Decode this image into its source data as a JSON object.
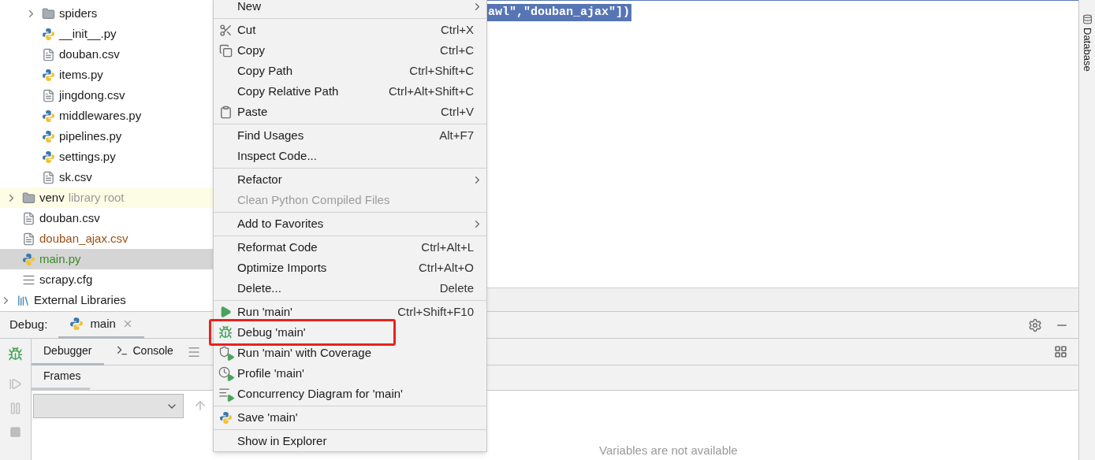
{
  "project_tree": [
    {
      "children": [
        {
          "children": [
            {
              "label": "spiders",
              "kind": "folder",
              "expanded": false,
              "selected": false
            },
            {
              "label": "__init__.py",
              "kind": "python",
              "selected": false
            },
            {
              "label": "douban.csv",
              "kind": "text",
              "selected": false
            },
            {
              "label": "items.py",
              "kind": "python",
              "selected": false
            },
            {
              "label": "jingdong.csv",
              "kind": "text",
              "selected": false
            },
            {
              "label": "middlewares.py",
              "kind": "python",
              "selected": false
            },
            {
              "label": "pipelines.py",
              "kind": "python",
              "selected": false
            },
            {
              "label": "settings.py",
              "kind": "python",
              "selected": false
            },
            {
              "label": "sk.csv",
              "kind": "text",
              "selected": false
            }
          ]
        },
        {
          "label": "venv",
          "suffix": "library root",
          "kind": "folder",
          "expanded": false,
          "selected": false
        },
        {
          "label": "douban.csv",
          "kind": "text",
          "selected": false
        },
        {
          "label": "douban_ajax.csv",
          "kind": "text",
          "selected": false,
          "color": "#9b4f16"
        },
        {
          "label": "main.py",
          "kind": "python",
          "selected": true,
          "color": "#3a8a28"
        },
        {
          "label": "scrapy.cfg",
          "kind": "config",
          "selected": false
        }
      ]
    },
    {
      "label": "External Libraries",
      "kind": "libraries",
      "expanded": false,
      "selected": false
    }
  ],
  "editor": {
    "lines": [
      {
        "text": "awl\",\"douban_ajax\"])",
        "selected": true
      }
    ]
  },
  "right_strip": {
    "label": "Database"
  },
  "debug_panel": {
    "label": "Debug:",
    "tabs": [
      {
        "label": "main",
        "selected": true
      }
    ],
    "views": [
      {
        "label": "Debugger",
        "selected": true
      },
      {
        "label": "Console",
        "selected": false
      }
    ],
    "frames": {
      "tabs": [
        {
          "label": "Frames",
          "selected": true
        }
      ]
    },
    "variables": {
      "message": "Variables are not available"
    }
  },
  "context_menu": {
    "groups": [
      [
        {
          "label": "New",
          "kind": "plain",
          "submenu": true
        }
      ],
      [
        {
          "label": "Cut",
          "shortcut": "Ctrl+X",
          "kind": "cut"
        },
        {
          "label": "Copy",
          "shortcut": "Ctrl+C",
          "kind": "copy"
        },
        {
          "label": "Copy Path",
          "shortcut": "Ctrl+Shift+C",
          "kind": "plain"
        },
        {
          "label": "Copy Relative Path",
          "shortcut": "Ctrl+Alt+Shift+C",
          "kind": "plain"
        },
        {
          "label": "Paste",
          "shortcut": "Ctrl+V",
          "kind": "paste"
        }
      ],
      [
        {
          "label": "Find Usages",
          "shortcut": "Alt+F7",
          "kind": "plain"
        },
        {
          "label": "Inspect Code...",
          "kind": "plain"
        }
      ],
      [
        {
          "label": "Refactor",
          "kind": "plain",
          "submenu": true
        },
        {
          "label": "Clean Python Compiled Files",
          "kind": "plain",
          "disabled": true
        }
      ],
      [
        {
          "label": "Add to Favorites",
          "kind": "plain",
          "submenu": true
        }
      ],
      [
        {
          "label": "Reformat Code",
          "shortcut": "Ctrl+Alt+L",
          "kind": "plain"
        },
        {
          "label": "Optimize Imports",
          "shortcut": "Ctrl+Alt+O",
          "kind": "plain"
        },
        {
          "label": "Delete...",
          "shortcut": "Delete",
          "kind": "plain"
        }
      ],
      [
        {
          "label": "Run 'main'",
          "shortcut": "Ctrl+Shift+F10",
          "kind": "run"
        },
        {
          "label": "Debug 'main'",
          "kind": "debug",
          "highlighted": true
        },
        {
          "label": "Run 'main' with Coverage",
          "kind": "coverage"
        },
        {
          "label": "Profile 'main'",
          "kind": "profile"
        },
        {
          "label": "Concurrency Diagram for 'main'",
          "kind": "concurrency"
        }
      ],
      [
        {
          "label": "Save 'main'",
          "kind": "python"
        }
      ],
      [
        {
          "label": "Show in Explorer",
          "kind": "plain"
        }
      ]
    ]
  }
}
